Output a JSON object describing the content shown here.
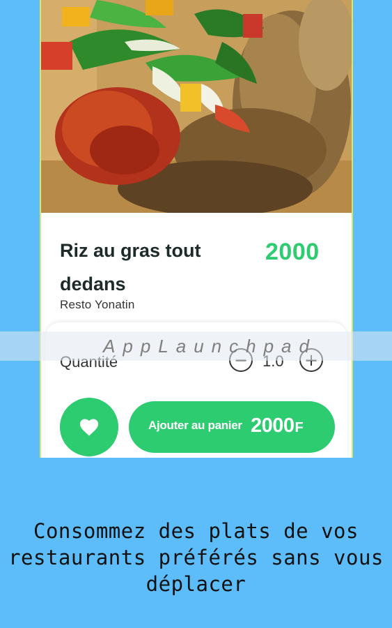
{
  "dish": {
    "title": "Riz au gras tout dedans",
    "price": "2000",
    "restaurant": "Resto Yonatin"
  },
  "quantity": {
    "label": "Quantité",
    "value": "1.0",
    "minus_symbol": "−",
    "plus_symbol": "+"
  },
  "actions": {
    "favorite_icon": "heart-icon",
    "add_to_cart_label": "Ajouter au panier",
    "add_to_cart_price": "2000",
    "currency": "F"
  },
  "watermark": "AppLaunchpad",
  "tagline": "Consommez des plats de vos restaurants préférés sans vous déplacer",
  "colors": {
    "background": "#5cbdfa",
    "accent_green": "#2ecc71",
    "card": "#ffffff"
  }
}
